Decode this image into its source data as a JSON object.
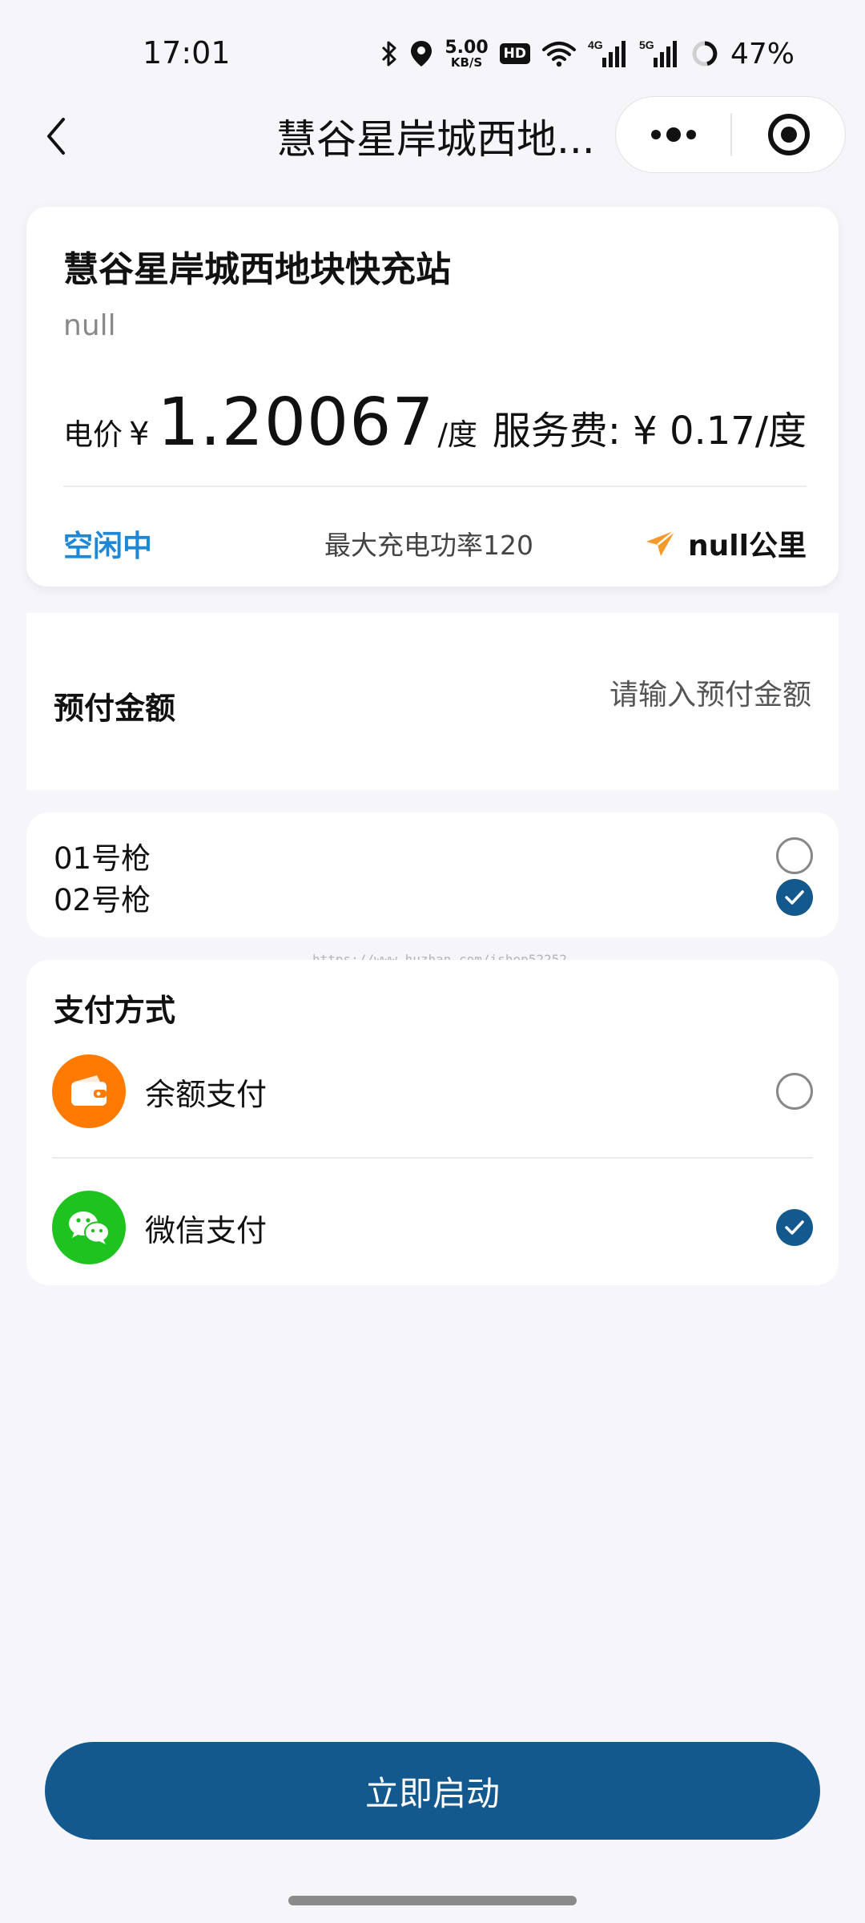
{
  "status_bar": {
    "time": "17:01",
    "net_speed_value": "5.00",
    "net_speed_unit": "KB/S",
    "hd_badge": "HD",
    "signal_4g": "4G",
    "signal_5g": "5G",
    "battery": "47%"
  },
  "nav": {
    "title": "慧谷星岸城西地..."
  },
  "station": {
    "name": "慧谷星岸城西地块快充站",
    "address": "null",
    "price_label": "电价",
    "currency": "¥",
    "price_value": "1.20067",
    "price_unit": "/度",
    "service_fee": "服务费: ¥ 0.17/度",
    "status": "空闲中",
    "max_power": "最大充电功率120",
    "distance": "null公里"
  },
  "prepay": {
    "label": "预付金额",
    "placeholder": "请输入预付金额"
  },
  "guns": [
    {
      "label": "01号枪",
      "checked": false
    },
    {
      "label": "02号枪",
      "checked": true
    }
  ],
  "watermark": "https://www.huzhan.com/ishop52252",
  "payment": {
    "title": "支付方式",
    "options": [
      {
        "label": "余额支付",
        "icon": "wallet-icon",
        "color": "#ff7a00",
        "checked": false
      },
      {
        "label": "微信支付",
        "icon": "wechat-icon",
        "color": "#1fc31f",
        "checked": true
      }
    ]
  },
  "start_button": "立即启动",
  "colors": {
    "accent": "#14598e",
    "status_blue": "#1e88d6",
    "nav_arrow": "#f39a2a",
    "background": "#f5f5fa"
  }
}
